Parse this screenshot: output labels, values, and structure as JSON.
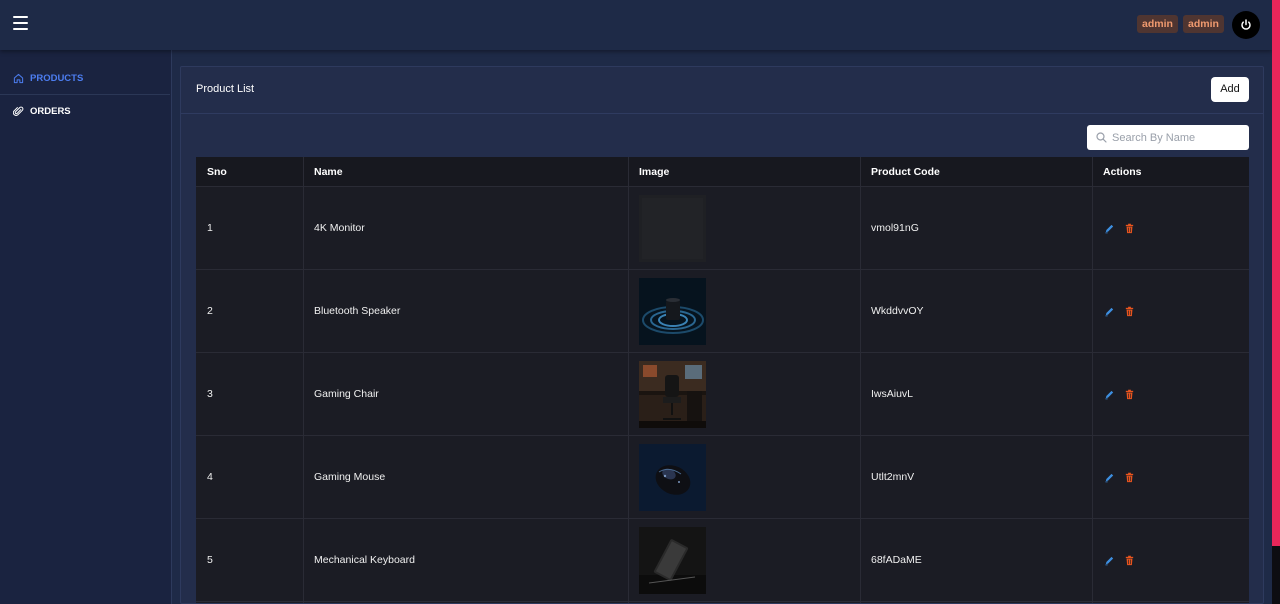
{
  "header": {
    "badges": [
      "admin",
      "admin"
    ]
  },
  "sidebar": {
    "items": [
      {
        "label": "PRODUCTS",
        "icon": "home-icon",
        "active": true
      },
      {
        "label": "ORDERS",
        "icon": "paperclip-icon",
        "active": false
      }
    ]
  },
  "main": {
    "title": "Product List",
    "add_label": "Add",
    "search_placeholder": "Search By Name",
    "columns": [
      "Sno",
      "Name",
      "Image",
      "Product Code",
      "Actions"
    ],
    "rows": [
      {
        "sno": "1",
        "name": "4K Monitor",
        "code": "vmol91nG"
      },
      {
        "sno": "2",
        "name": "Bluetooth Speaker",
        "code": "WkddvvOY"
      },
      {
        "sno": "3",
        "name": "Gaming Chair",
        "code": "IwsAiuvL"
      },
      {
        "sno": "4",
        "name": "Gaming Mouse",
        "code": "Utlt2mnV"
      },
      {
        "sno": "5",
        "name": "Mechanical Keyboard",
        "code": "68fADaME"
      }
    ]
  },
  "colors": {
    "accent": "#4c7df0",
    "edit": "#3d8fe0",
    "delete": "#e8541e",
    "badge_text": "#f09a6f",
    "strip": "#e8265a"
  }
}
